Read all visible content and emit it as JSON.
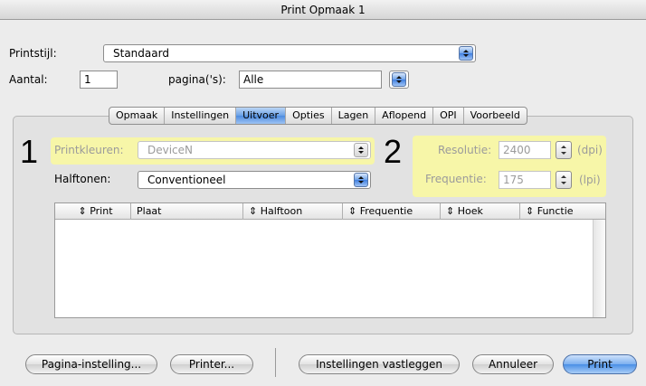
{
  "window": {
    "title": "Print Opmaak 1"
  },
  "printstijl": {
    "label": "Printstijl:",
    "value": "Standaard"
  },
  "aantal": {
    "label": "Aantal:",
    "value": "1"
  },
  "paginas": {
    "label": "pagina('s):",
    "value": "Alle"
  },
  "tabs": [
    "Opmaak",
    "Instellingen",
    "Uitvoer",
    "Opties",
    "Lagen",
    "Aflopend",
    "OPI",
    "Voorbeeld"
  ],
  "active_tab": "Uitvoer",
  "annotations": {
    "one": "1",
    "two": "2"
  },
  "printkleuren": {
    "label": "Printkleuren:",
    "value": "DeviceN"
  },
  "halftonen": {
    "label": "Halftonen:",
    "value": "Conventioneel"
  },
  "resolutie": {
    "label": "Resolutie:",
    "value": "2400",
    "unit": "(dpi)"
  },
  "frequentie": {
    "label": "Frequentie:",
    "value": "175",
    "unit": "(lpi)"
  },
  "table": {
    "columns": [
      "Print",
      "Plaat",
      "Halftoon",
      "Frequentie",
      "Hoek",
      "Functie"
    ],
    "rows": []
  },
  "buttons": {
    "pagina_instelling": "Pagina-instelling...",
    "printer": "Printer...",
    "instellingen_vastleggen": "Instellingen vastleggen",
    "annuleer": "Annuleer",
    "print": "Print"
  },
  "colors": {
    "highlight": "#f7f6a8",
    "accent": "#4a8fe6"
  }
}
